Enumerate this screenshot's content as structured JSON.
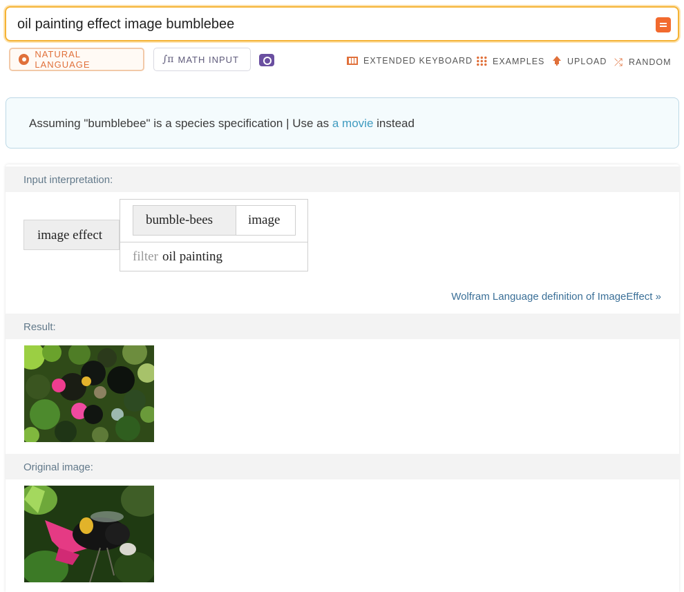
{
  "search": {
    "query": "oil painting effect image bumblebee"
  },
  "modes": {
    "natural_language": "NATURAL LANGUAGE",
    "math_input": "MATH INPUT"
  },
  "tools": {
    "extended_keyboard": "EXTENDED KEYBOARD",
    "examples": "EXAMPLES",
    "upload": "UPLOAD",
    "random": "RANDOM"
  },
  "assumption": {
    "prefix": "Assuming \"bumblebee\" is a species specification | Use as ",
    "link": "a movie",
    "suffix": " instead"
  },
  "pods": {
    "input_title": "Input interpretation:",
    "interp": {
      "function": "image effect",
      "entity": "bumble-bees",
      "property": "image",
      "filter_label": "filter",
      "filter_value": "oil painting"
    },
    "definition_link": "Wolfram Language definition of ImageEffect »",
    "result_title": "Result:",
    "original_title": "Original image:"
  },
  "colors": {
    "accent": "#f26a2e",
    "search_border": "#f5b335",
    "link": "#3f9bc0",
    "pod_title": "#62798a"
  }
}
